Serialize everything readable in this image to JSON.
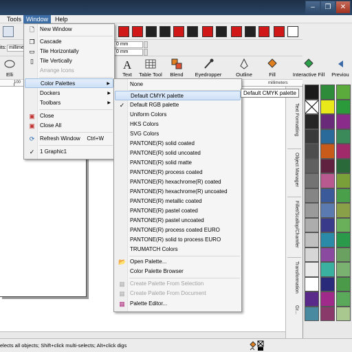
{
  "menubar": {
    "tools": "Tools",
    "window": "Window",
    "help": "Help"
  },
  "window_controls": {
    "minimize": "–",
    "restore": "❐",
    "close": "✕"
  },
  "window_menu": {
    "items": [
      {
        "label": "New Window",
        "mnemonic": "N"
      },
      {
        "label": "Cascade"
      },
      {
        "label": "Tile Horizontally"
      },
      {
        "label": "Tile Vertically"
      },
      {
        "label": "Arrange Icons",
        "disabled": true
      },
      {
        "label": "Color Palettes",
        "submenu": true
      },
      {
        "label": "Dockers",
        "submenu": true
      },
      {
        "label": "Toolbars",
        "submenu": true
      },
      {
        "label": "Close"
      },
      {
        "label": "Close All"
      },
      {
        "label": "Refresh Window",
        "shortcut": "Ctrl+W"
      },
      {
        "label": "1 Graphic1",
        "checked": true
      }
    ]
  },
  "palette_menu": {
    "items": [
      {
        "label": "None"
      },
      {
        "label": "Default CMYK palette"
      },
      {
        "label": "Default RGB palette",
        "checked": true
      },
      {
        "label": "Uniform Colors"
      },
      {
        "label": "HKS Colors"
      },
      {
        "label": "SVG Colors"
      },
      {
        "label": "PANTONE(R) solid coated"
      },
      {
        "label": "PANTONE(R) solid uncoated"
      },
      {
        "label": "PANTONE(R) solid matte"
      },
      {
        "label": "PANTONE(R) process coated"
      },
      {
        "label": "PANTONE(R) hexachrome(R) coated"
      },
      {
        "label": "PANTONE(R) hexachrome(R) uncoated"
      },
      {
        "label": "PANTONE(R) metallic coated"
      },
      {
        "label": "PANTONE(R) pastel coated"
      },
      {
        "label": "PANTONE(R) pastel uncoated"
      },
      {
        "label": "PANTONE(R) process coated EURO"
      },
      {
        "label": "PANTONE(R) solid to process EURO"
      },
      {
        "label": "TRUMATCH Colors"
      },
      {
        "label": "Open Palette..."
      },
      {
        "label": "Color Palette Browser"
      },
      {
        "label": "Create Palette From Selection",
        "disabled": true
      },
      {
        "label": "Create Palette From Document",
        "disabled": true
      },
      {
        "label": "Palette Editor..."
      }
    ]
  },
  "tooltip": "Default CMYK palette",
  "propbar": {
    "units_label": "its:",
    "units_value": "millimet",
    "dim1": "0 mm",
    "dim2": "0 mm"
  },
  "ribbon": [
    {
      "label": "Elli"
    },
    {
      "label": "Text"
    },
    {
      "label": "Table Tool"
    },
    {
      "label": "Blend"
    },
    {
      "label": "Eyedropper"
    },
    {
      "label": "Outline"
    },
    {
      "label": "Fill"
    },
    {
      "label": "Interactive Fill"
    },
    {
      "label": "Previou"
    }
  ],
  "ruler": {
    "tick_100": "100",
    "units": "millimeters"
  },
  "dockers": [
    {
      "label": "Text Formatting"
    },
    {
      "label": "Object Manager"
    },
    {
      "label": "Fillet/Scallop/Chamfer"
    },
    {
      "label": "Transformation"
    },
    {
      "label": "Gr..."
    }
  ],
  "status_text": "elects all objects; Shift+click multi-selects; Alt+click digs",
  "swatches": [
    "#1a1a1a",
    "#2e8b3a",
    "#5aaa3c",
    "#ffffff",
    "#e8e81a",
    "#2a9a3a",
    "#262626",
    "#6a2a7a",
    "#8a2c8a",
    "#3a3a3a",
    "#2a6a9a",
    "#3a8a5a",
    "#4d4d4d",
    "#c85a1a",
    "#a02a6a",
    "#606060",
    "#602040",
    "#2a6a3a",
    "#737373",
    "#b85a90",
    "#7aa03a",
    "#858585",
    "#3a5a9a",
    "#4aa04a",
    "#9a9a9a",
    "#5a7ab0",
    "#8aa048",
    "#adadad",
    "#3a3a8a",
    "#6ab05a",
    "#c0c0c0",
    "#2a8aa8",
    "#2a9a4a",
    "#d6d6d6",
    "#8a4aa0",
    "#6aa060",
    "#eaeaea",
    "#3ab0a0",
    "#7ab070",
    "#ffffff",
    "#2a2a7a",
    "#4a9a4a",
    "#5a2a8a",
    "#a02a8a",
    "#5aa85a",
    "#4a8aa0",
    "#8a3a6a",
    "#a8c890"
  ]
}
